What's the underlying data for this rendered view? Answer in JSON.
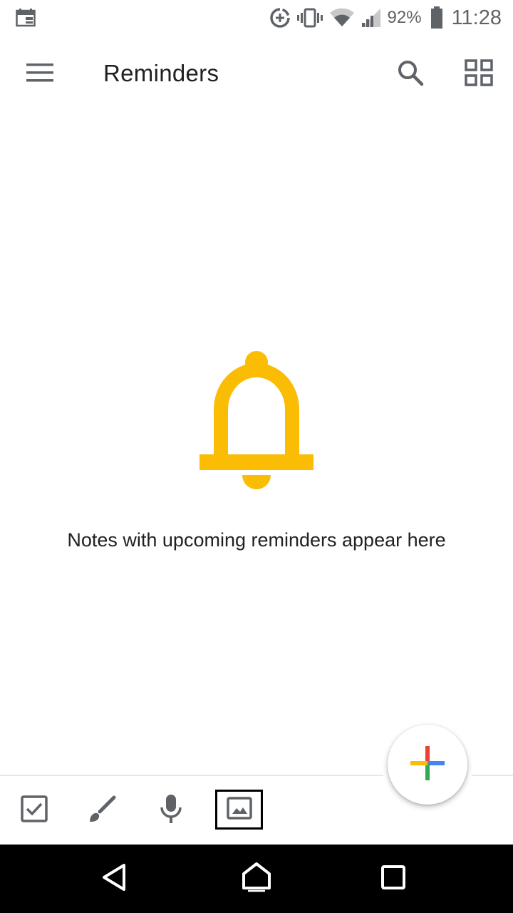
{
  "status_bar": {
    "battery_percent": "92%",
    "time": "11:28",
    "icons": [
      "calendar-notification-icon",
      "data-saver-icon",
      "vibrate-icon",
      "wifi-icon",
      "cell-signal-icon",
      "battery-icon"
    ]
  },
  "app_bar": {
    "title": "Reminders",
    "icons": [
      "menu-icon",
      "search-icon",
      "grid-view-icon"
    ]
  },
  "empty_state": {
    "icon": "bell-icon",
    "message": "Notes with upcoming reminders appear here"
  },
  "bottom_bar": {
    "tools": [
      "checkbox-icon",
      "brush-icon",
      "microphone-icon",
      "image-icon"
    ]
  },
  "fab": {
    "icon": "plus-icon"
  },
  "nav_bar": {
    "icons": [
      "back-icon",
      "home-icon",
      "recents-icon"
    ]
  },
  "colors": {
    "accent_yellow": "#FBBC04",
    "icon_gray": "#5f6368",
    "google_red": "#EA4335",
    "google_blue": "#4285F4",
    "google_yellow": "#FBBC04",
    "google_green": "#34A853"
  }
}
